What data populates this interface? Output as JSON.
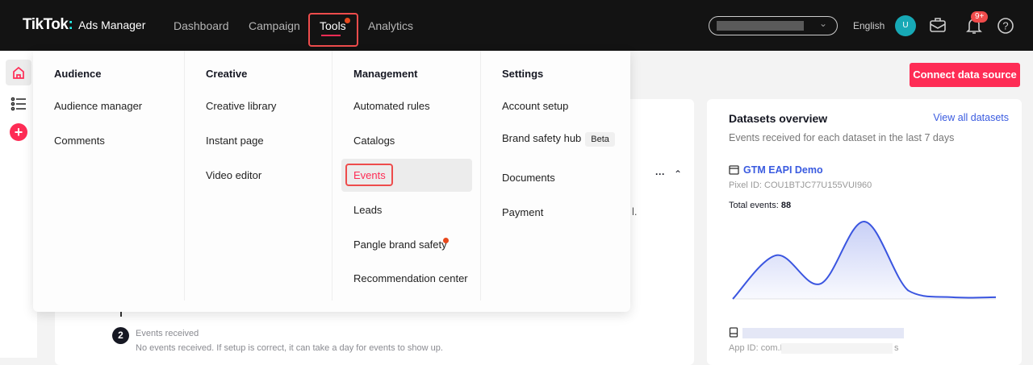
{
  "header": {
    "logo": "TikTok",
    "logo_sub": "Ads Manager",
    "nav": [
      "Dashboard",
      "Campaign",
      "Tools",
      "Analytics"
    ],
    "language": "English",
    "avatar_initial": "U",
    "notification_badge": "9+"
  },
  "menu": {
    "columns": [
      {
        "heading": "Audience",
        "items": [
          "Audience manager",
          "Comments"
        ]
      },
      {
        "heading": "Creative",
        "items": [
          "Creative library",
          "Instant page",
          "Video editor"
        ]
      },
      {
        "heading": "Management",
        "items": [
          "Automated rules",
          "Catalogs",
          "Events",
          "Leads",
          "Pangle brand safety",
          "Recommendation center"
        ]
      },
      {
        "heading": "Settings",
        "items": [
          "Account setup",
          "Brand safety hub",
          "Documents",
          "Payment"
        ],
        "beta": "Beta"
      }
    ]
  },
  "actions": {
    "connect": "Connect data source"
  },
  "main": {
    "step_number": "2",
    "step_title": "Events received",
    "step_desc": "No events received. If setup is correct, it can take a day for events to show up.",
    "more": "···",
    "partial": "l."
  },
  "datasets": {
    "title": "Datasets overview",
    "view_all": "View all datasets",
    "subtitle": "Events received for each dataset in the last 7 days",
    "name": "GTM EAPI Demo",
    "pixel_id": "Pixel ID: COU1BTJC77U155VUI960",
    "total_label": "Total events:",
    "total": "88",
    "app_id_prefix": "App ID: com.H",
    "app_id_suffix": "s"
  },
  "chart_data": {
    "type": "area",
    "values": [
      0,
      26,
      9,
      46,
      5,
      1,
      1
    ],
    "color": "#3a55e0"
  },
  "colors": {
    "accent": "#fe2c55",
    "link": "#3a5be0"
  }
}
